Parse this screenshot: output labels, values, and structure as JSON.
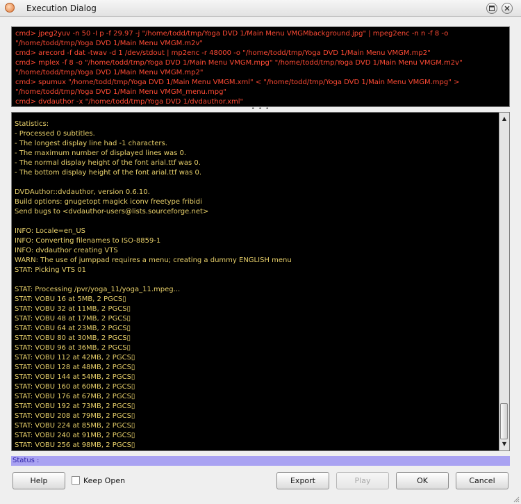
{
  "window": {
    "title": "Execution Dialog",
    "icon": "app-icon",
    "controls": [
      "maximize-icon",
      "close-icon"
    ]
  },
  "commands": [
    "cmd> jpeg2yuv -n 50 -I p -f 29.97 -j \"/home/todd/tmp/Yoga DVD 1/Main Menu VMGMbackground.jpg\" | mpeg2enc -n n -f 8 -o",
    "\"/home/todd/tmp/Yoga DVD 1/Main Menu VMGM.m2v\"",
    "cmd> arecord -f dat -twav -d 1 /dev/stdout | mp2enc -r 48000 -o \"/home/todd/tmp/Yoga DVD 1/Main Menu VMGM.mp2\"",
    "cmd> mplex -f 8 -o \"/home/todd/tmp/Yoga DVD 1/Main Menu VMGM.mpg\" \"/home/todd/tmp/Yoga DVD 1/Main Menu VMGM.m2v\"",
    "\"/home/todd/tmp/Yoga DVD 1/Main Menu VMGM.mp2\"",
    "cmd> spumux \"/home/todd/tmp/Yoga DVD 1/Main Menu VMGM.xml\" < \"/home/todd/tmp/Yoga DVD 1/Main Menu VMGM.mpg\" >",
    "\"/home/todd/tmp/Yoga DVD 1/Main Menu VMGM_menu.mpg\"",
    "cmd> dvdauthor -x \"/home/todd/tmp/Yoga DVD 1/dvdauthor.xml\""
  ],
  "log": [
    "Statistics:",
    "- Processed 0 subtitles.",
    "- The longest display line had -1 characters.",
    "- The maximum number of displayed lines was 0.",
    "- The normal display height of the font arial.ttf was 0.",
    "- The bottom display height of the font arial.ttf was 0.",
    "",
    "DVDAuthor::dvdauthor, version 0.6.10.",
    "Build options: gnugetopt magick iconv freetype fribidi",
    "Send bugs to <dvdauthor-users@lists.sourceforge.net>",
    "",
    "INFO: Locale=en_US",
    "INFO: Converting filenames to ISO-8859-1",
    "INFO: dvdauthor creating VTS",
    "WARN: The use of jumppad requires a menu; creating a dummy ENGLISH menu",
    "STAT: Picking VTS 01",
    "",
    "STAT: Processing /pvr/yoga_11/yoga_11.mpeg...",
    "STAT: VOBU 16 at 5MB, 2 PGCS▯",
    "STAT: VOBU 32 at 11MB, 2 PGCS▯",
    "STAT: VOBU 48 at 17MB, 2 PGCS▯",
    "STAT: VOBU 64 at 23MB, 2 PGCS▯",
    "STAT: VOBU 80 at 30MB, 2 PGCS▯",
    "STAT: VOBU 96 at 36MB, 2 PGCS▯",
    "STAT: VOBU 112 at 42MB, 2 PGCS▯",
    "STAT: VOBU 128 at 48MB, 2 PGCS▯",
    "STAT: VOBU 144 at 54MB, 2 PGCS▯",
    "STAT: VOBU 160 at 60MB, 2 PGCS▯",
    "STAT: VOBU 176 at 67MB, 2 PGCS▯",
    "STAT: VOBU 192 at 73MB, 2 PGCS▯",
    "STAT: VOBU 208 at 79MB, 2 PGCS▯",
    "STAT: VOBU 224 at 85MB, 2 PGCS▯",
    "STAT: VOBU 240 at 91MB, 2 PGCS▯",
    "STAT: VOBU 256 at 98MB, 2 PGCS▯"
  ],
  "status": {
    "label": "Status :"
  },
  "buttons": {
    "help": "Help",
    "keep_open": "Keep Open",
    "keep_open_checked": false,
    "export": "Export",
    "play": "Play",
    "ok": "OK",
    "cancel": "Cancel"
  },
  "colors": {
    "command_text": "#ff4a34",
    "log_text": "#e8d06a",
    "status_bg": "#a9a2f2",
    "status_text": "#2f24a8"
  }
}
